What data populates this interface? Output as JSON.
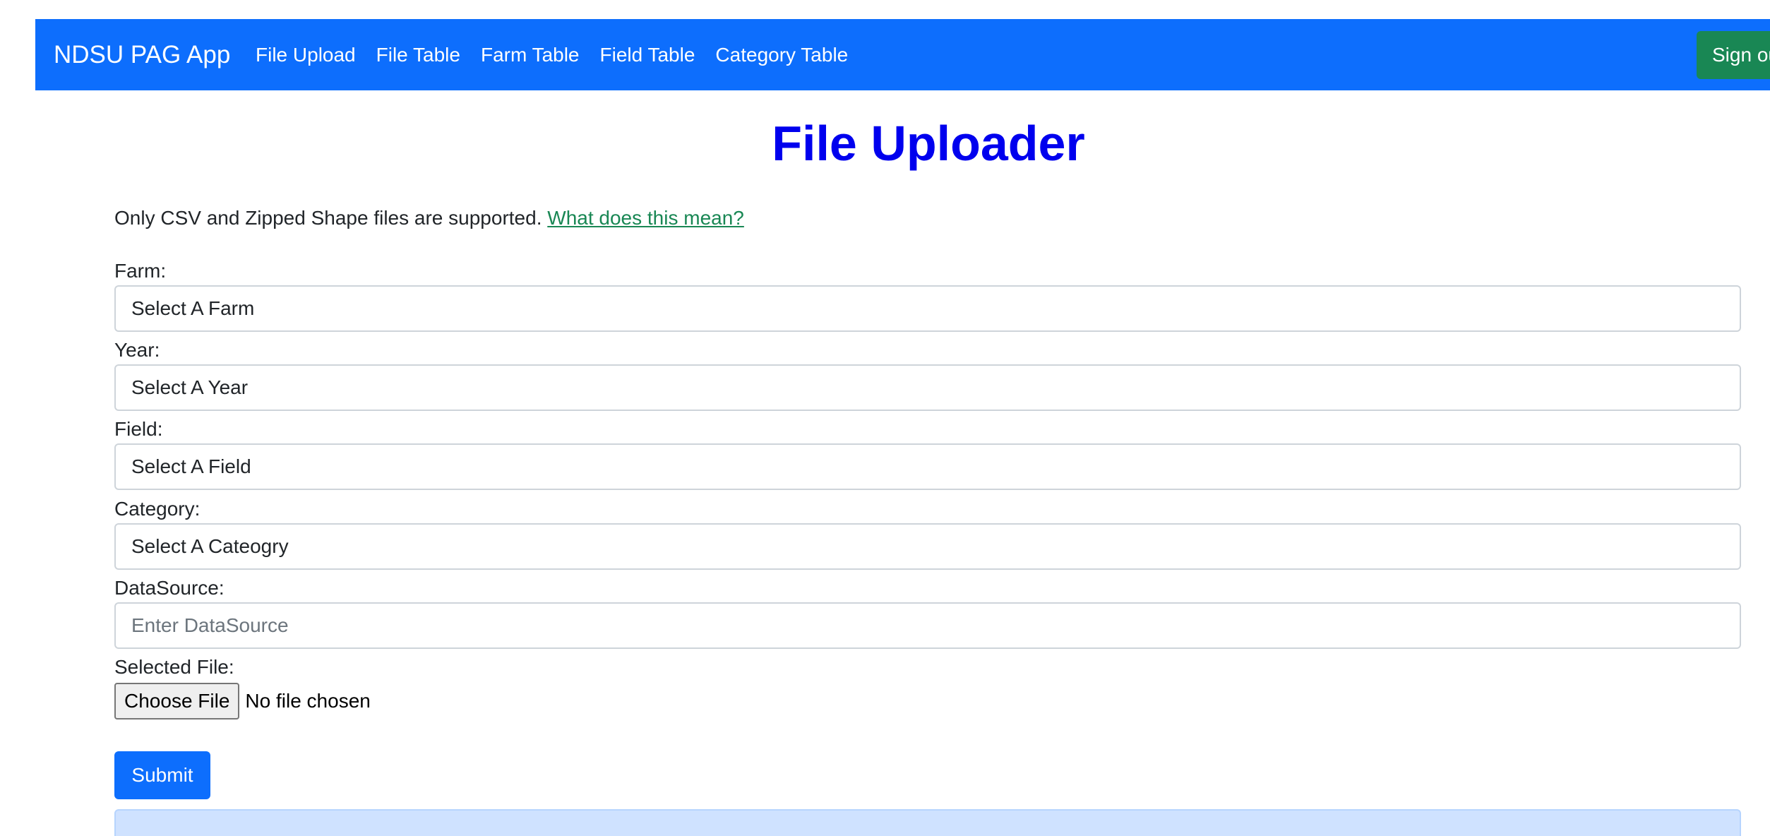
{
  "navbar": {
    "brand": "NDSU PAG App",
    "links": [
      "File Upload",
      "File Table",
      "Farm Table",
      "Field Table",
      "Category Table"
    ],
    "signout_label": "Sign out"
  },
  "page": {
    "title": "File Uploader",
    "intro_text": "Only CSV and Zipped Shape files are supported. ",
    "intro_link": "What does this mean?"
  },
  "form": {
    "farm_label": "Farm:",
    "farm_value": "Select A Farm",
    "year_label": "Year:",
    "year_value": "Select A Year",
    "field_label": "Field:",
    "field_value": "Select A Field",
    "category_label": "Category:",
    "category_value": "Select A Cateogry",
    "datasource_label": "DataSource:",
    "datasource_placeholder": "Enter DataSource",
    "file_label": "Selected File:",
    "file_button": "Choose File",
    "file_status": "No file chosen",
    "submit_label": "Submit"
  },
  "colors": {
    "navbar": "#0d6efd",
    "signout": "#198754",
    "heading": "#0000ee",
    "link": "#198754",
    "alert": "#cfe2ff"
  }
}
